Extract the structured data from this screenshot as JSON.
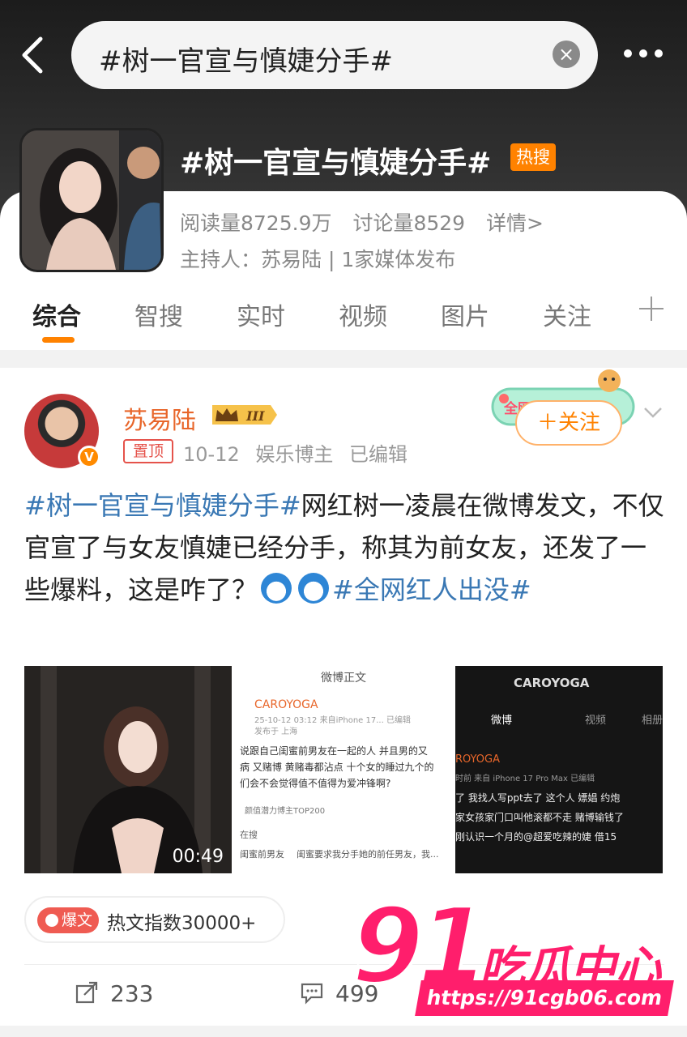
{
  "search": {
    "query": "#树一官宣与慎婕分手#",
    "clear_icon": "close-circle-icon"
  },
  "topic": {
    "title": "#树一官宣与慎婕分手#",
    "badge": "热搜",
    "reads": "阅读量8725.9万",
    "discussions": "讨论量8529",
    "details": "详情>",
    "host": "主持人：苏易陆 | 1家媒体发布"
  },
  "tabs": [
    "综合",
    "智搜",
    "实时",
    "视频",
    "图片",
    "关注"
  ],
  "post": {
    "user": "苏易陆",
    "level": "III",
    "pinned": "置顶",
    "date": "10-12",
    "role": "娱乐博主",
    "edited": "已编辑",
    "follow": "＋关注",
    "promo": "全网红人出没",
    "text_tag": "#树一官宣与慎婕分手#",
    "text_body": "网红树一凌晨在微博发文，不仅官宣了与女友慎婕已经分手，称其为前女友，还发了一些爆料，这是咋了？",
    "text_tag2": "#全网红人出没#",
    "media": {
      "video_duration": "00:49",
      "m2_header": "微博正文",
      "m2_user": "CAROYOGA",
      "m2_time": "25-10-12 03:12 来自iPhone 17...  已编辑",
      "m2_loc": "发布于 上海",
      "m2_line1": "说跟自己闺蜜前男友在一起的人 并且男的又",
      "m2_line2": "病 又赌博 黄赌毒都沾点 十个女的睡过九个的",
      "m2_line3": "们会不会觉得值不值得为爱冲锋啊?",
      "m2_rank": "颜值潜力博主TOP200",
      "m2_search": "在搜",
      "m2_q1": "闺蜜前男友",
      "m2_q2": "闺蜜要求我分手她的前任男友，我...",
      "m3_title": "CAROYOGA",
      "m3_tab1": "微博",
      "m3_tab2": "视频",
      "m3_tab3": "相册",
      "m3_user": "ROYOGA",
      "m3_meta": "时前  来自 iPhone 17 Pro Max  已编辑",
      "m3_line1": "了 我找人写ppt去了 这个人 嫖娼 约炮",
      "m3_line2": "家女孩家门口叫他滚都不走 赌博输钱了",
      "m3_line3": "刚认识一个月的@超爱吃辣的婕 借15"
    },
    "hot_badge": "爆文",
    "hot_index": "热文指数30000+",
    "reposts": "233",
    "comments": "499"
  },
  "watermark": {
    "number": "91",
    "brand": "吃瓜中心",
    "url": "https://91cgb06.com"
  },
  "colors": {
    "accent": "#ff8200",
    "link": "#3a78b4",
    "watermark": "#ff1e6c"
  }
}
